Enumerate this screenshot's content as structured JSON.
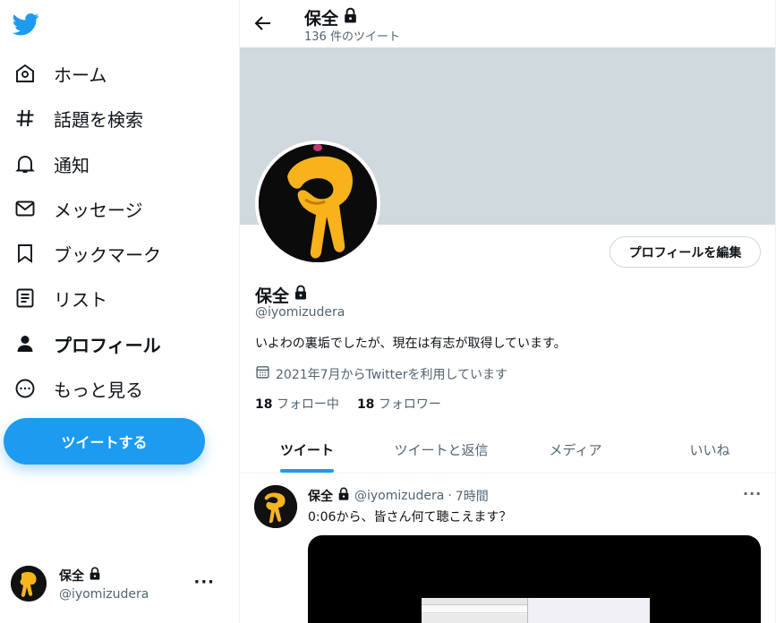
{
  "colors": {
    "accent": "#1d9bf0",
    "text": "#0f1419",
    "muted": "#536471",
    "banner": "#cfd9de"
  },
  "sidebar": {
    "logo_icon": "twitter-bird-icon",
    "items": [
      {
        "label": "ホーム",
        "icon": "home-icon"
      },
      {
        "label": "話題を検索",
        "icon": "hashtag-icon"
      },
      {
        "label": "通知",
        "icon": "bell-icon"
      },
      {
        "label": "メッセージ",
        "icon": "mail-icon"
      },
      {
        "label": "ブックマーク",
        "icon": "bookmark-icon"
      },
      {
        "label": "リスト",
        "icon": "list-icon"
      },
      {
        "label": "プロフィール",
        "icon": "profile-icon",
        "active": true
      },
      {
        "label": "もっと見る",
        "icon": "more-circle-icon"
      }
    ],
    "tweet_button": "ツイートする",
    "account": {
      "name": "保全",
      "handle": "@iyomizudera",
      "more": "···"
    }
  },
  "header": {
    "title": "保全",
    "subtitle": "136 件のツイート"
  },
  "profile": {
    "edit_button": "プロフィールを編集",
    "name": "保全",
    "handle": "@iyomizudera",
    "bio": "いよわの裏垢でしたが、現在は有志が取得しています。",
    "joined": "2021年7月からTwitterを利用しています",
    "following_count": "18",
    "following_label": "フォロー中",
    "followers_count": "18",
    "followers_label": "フォロワー"
  },
  "tabs": [
    {
      "label": "ツイート",
      "active": true
    },
    {
      "label": "ツイートと返信"
    },
    {
      "label": "メディア"
    },
    {
      "label": "いいね"
    }
  ],
  "tweet": {
    "name": "保全",
    "handle": "@iyomizudera",
    "separator": "·",
    "time": "7時間",
    "text": "0:06から、皆さん何て聴こえます？",
    "more": "···"
  }
}
